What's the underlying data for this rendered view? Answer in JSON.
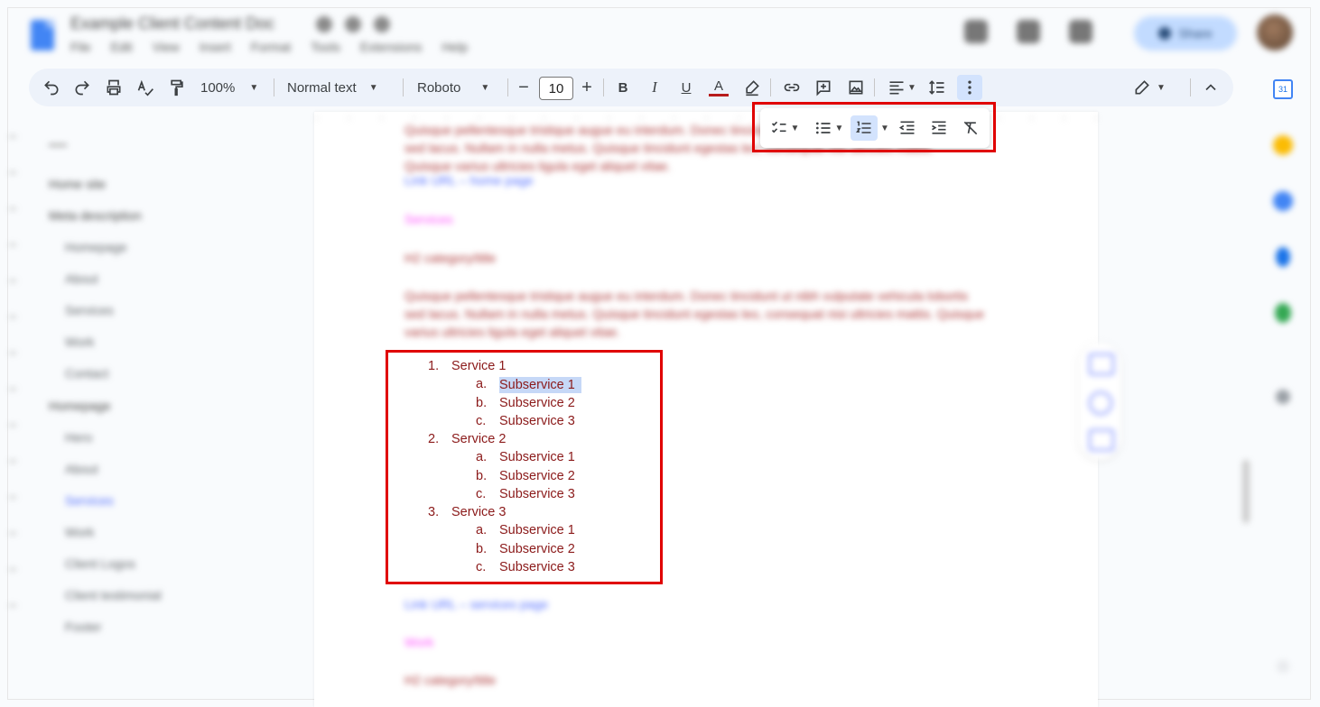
{
  "document": {
    "title": "Example Client Content Doc",
    "menus": [
      "File",
      "Edit",
      "View",
      "Insert",
      "Format",
      "Tools",
      "Extensions",
      "Help"
    ],
    "share_label": "Share"
  },
  "toolbar": {
    "zoom": "100%",
    "style": "Normal text",
    "font": "Roboto",
    "font_size": "10",
    "text_color_letter": "A",
    "bold": "B",
    "italic": "I",
    "underline": "U"
  },
  "list_tools": {
    "icons": [
      "checklist-icon",
      "bulleted-list-icon",
      "numbered-list-icon",
      "decrease-indent-icon",
      "increase-indent-icon",
      "clear-formatting-icon"
    ],
    "highlight_color": "#e00000"
  },
  "outline": {
    "items": [
      "Home site",
      "Meta description",
      "Homepage",
      "About",
      "Services",
      "Work",
      "Contact",
      "Homepage",
      "Hero",
      "About",
      "Services",
      "Work",
      "Client Logos",
      "Client testimonial",
      "Footer"
    ]
  },
  "body": {
    "text_color": "#8b1a1a",
    "link_lines": [
      "Link URL – home page",
      "Link URL – services page"
    ],
    "pink_labels": [
      "Services",
      "Work"
    ],
    "headings": [
      "H2 category/title",
      "H2 category/title"
    ],
    "paragraph": "Quisque pellentesque tristique augue eu interdum. Donec tincidunt ut nibh vulputate vehicula lobortis sed lacus. Nullam in nulla metus. Quisque tincidunt egestas leo, consequat nisi ultricies mattis. Quisque varius ultricies ligula eget aliquet vitae."
  },
  "services_list": [
    {
      "num": "1.",
      "label": "Service 1",
      "subs": [
        {
          "num": "a.",
          "label": "Subservice 1",
          "selected": true
        },
        {
          "num": "b.",
          "label": "Subservice 2"
        },
        {
          "num": "c.",
          "label": "Subservice 3"
        }
      ]
    },
    {
      "num": "2.",
      "label": "Service 2",
      "subs": [
        {
          "num": "a.",
          "label": "Subservice 1"
        },
        {
          "num": "b.",
          "label": "Subservice 2"
        },
        {
          "num": "c.",
          "label": "Subservice 3"
        }
      ]
    },
    {
      "num": "3.",
      "label": "Service 3",
      "subs": [
        {
          "num": "a.",
          "label": "Subservice 1"
        },
        {
          "num": "b.",
          "label": "Subservice 2"
        },
        {
          "num": "c.",
          "label": "Subservice 3"
        }
      ]
    }
  ],
  "colors": {
    "toolbar_bg": "#edf2fa",
    "active_tool": "#d3e3fd",
    "selection": "#c6d8f7",
    "link_blue": "#4f6bff",
    "pink": "#ff4dff"
  }
}
